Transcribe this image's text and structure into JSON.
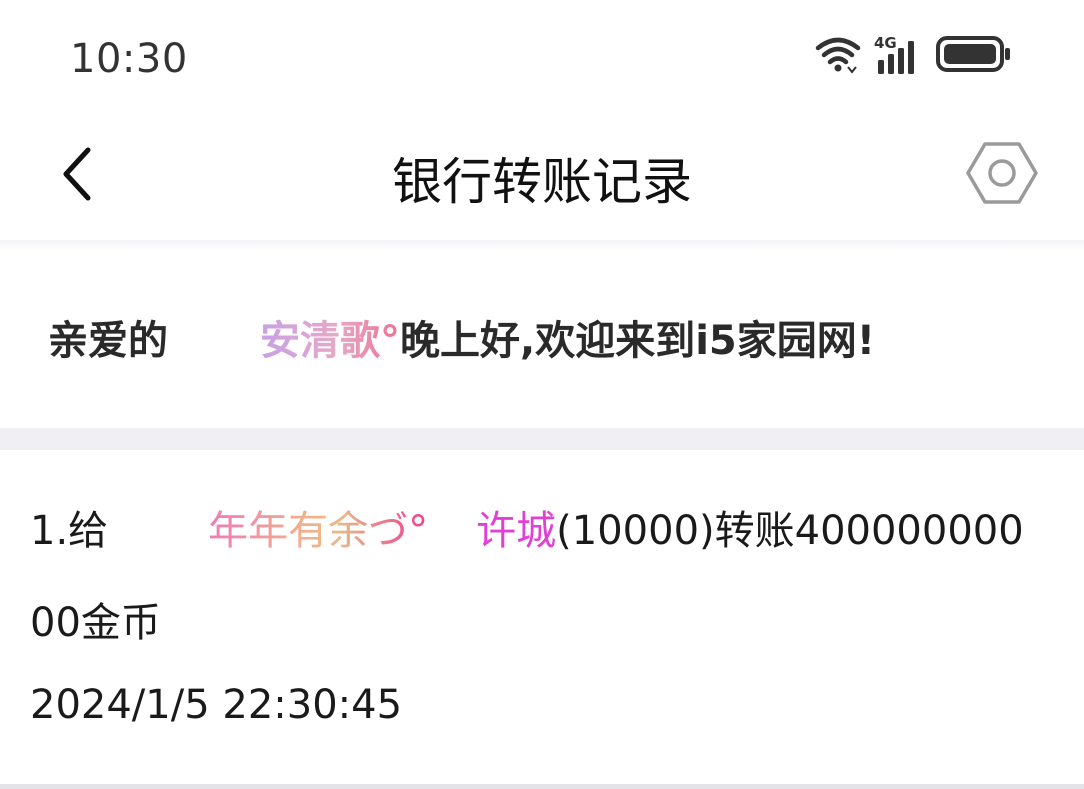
{
  "status_bar": {
    "time": "10:30",
    "network": "4G",
    "icons": [
      "wifi-icon",
      "signal-icon",
      "battery-icon"
    ]
  },
  "header": {
    "title": "银行转账记录",
    "back_icon": "chevron-left-icon",
    "settings_icon": "hexagon-settings-icon"
  },
  "welcome": {
    "prefix": "亲爱的",
    "name": "安清歌°",
    "suffix": "晚上好,欢迎来到i5家园网!"
  },
  "records": [
    {
      "index_prefix": "1.给",
      "sender": "年年有余づ°",
      "receiver": "许城",
      "detail": "(10000)转账400000000",
      "detail_cont": "00金币",
      "time": "2024/1/5 22:30:45"
    }
  ],
  "colors": {
    "receiver": "#e23fd6",
    "divider": "#f0f0f4"
  }
}
